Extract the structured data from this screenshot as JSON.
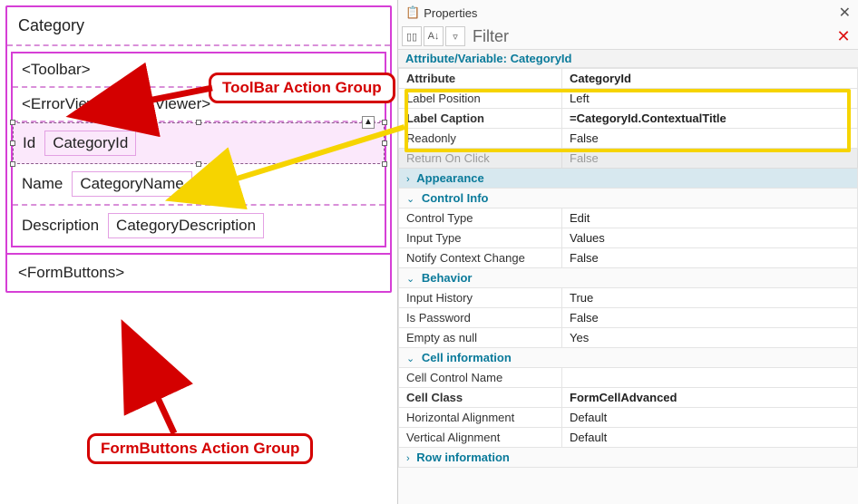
{
  "designer": {
    "formTitle": "Category",
    "toolbarPlaceholder": "<Toolbar>",
    "errorViewer": "<ErrorViewer: ErrorViewer>",
    "fields": [
      {
        "label": "Id",
        "value": "CategoryId",
        "selected": true
      },
      {
        "label": "Name",
        "value": "CategoryName",
        "selected": false
      },
      {
        "label": "Description",
        "value": "CategoryDescription",
        "selected": false
      }
    ],
    "formButtons": "<FormButtons>"
  },
  "annotations": {
    "toolbarLabel": "ToolBar Action Group",
    "formButtonsLabel": "FormButtons Action Group"
  },
  "properties": {
    "panelTitle": "Properties",
    "filterLabel": "Filter",
    "filterValue": "",
    "heading": "Attribute/Variable: CategoryId",
    "rows": [
      {
        "k": "Attribute",
        "v": "CategoryId",
        "bold": true
      },
      {
        "k": "Label Position",
        "v": "Left"
      },
      {
        "k": "Label Caption",
        "v": "=CategoryId.ContextualTitle",
        "bold": true
      },
      {
        "k": "Readonly",
        "v": "False"
      },
      {
        "k": "Return On Click",
        "v": "False",
        "dim": true
      }
    ],
    "groups": [
      {
        "name": "Appearance",
        "expanded": false,
        "highlight": true
      },
      {
        "name": "Control Info",
        "expanded": true,
        "rows": [
          {
            "k": "Control Type",
            "v": "Edit"
          },
          {
            "k": "Input Type",
            "v": "Values"
          },
          {
            "k": "Notify Context Change",
            "v": "False"
          }
        ]
      },
      {
        "name": "Behavior",
        "expanded": true,
        "rows": [
          {
            "k": "Input History",
            "v": "True"
          },
          {
            "k": "Is Password",
            "v": "False"
          },
          {
            "k": "Empty as null",
            "v": "Yes"
          }
        ]
      },
      {
        "name": "Cell information",
        "expanded": true,
        "rows": [
          {
            "k": "Cell Control Name",
            "v": ""
          },
          {
            "k": "Cell Class",
            "v": "FormCellAdvanced",
            "bold": true
          },
          {
            "k": "Horizontal Alignment",
            "v": "Default"
          },
          {
            "k": "Vertical Alignment",
            "v": "Default"
          }
        ]
      },
      {
        "name": "Row information",
        "expanded": false
      }
    ]
  }
}
